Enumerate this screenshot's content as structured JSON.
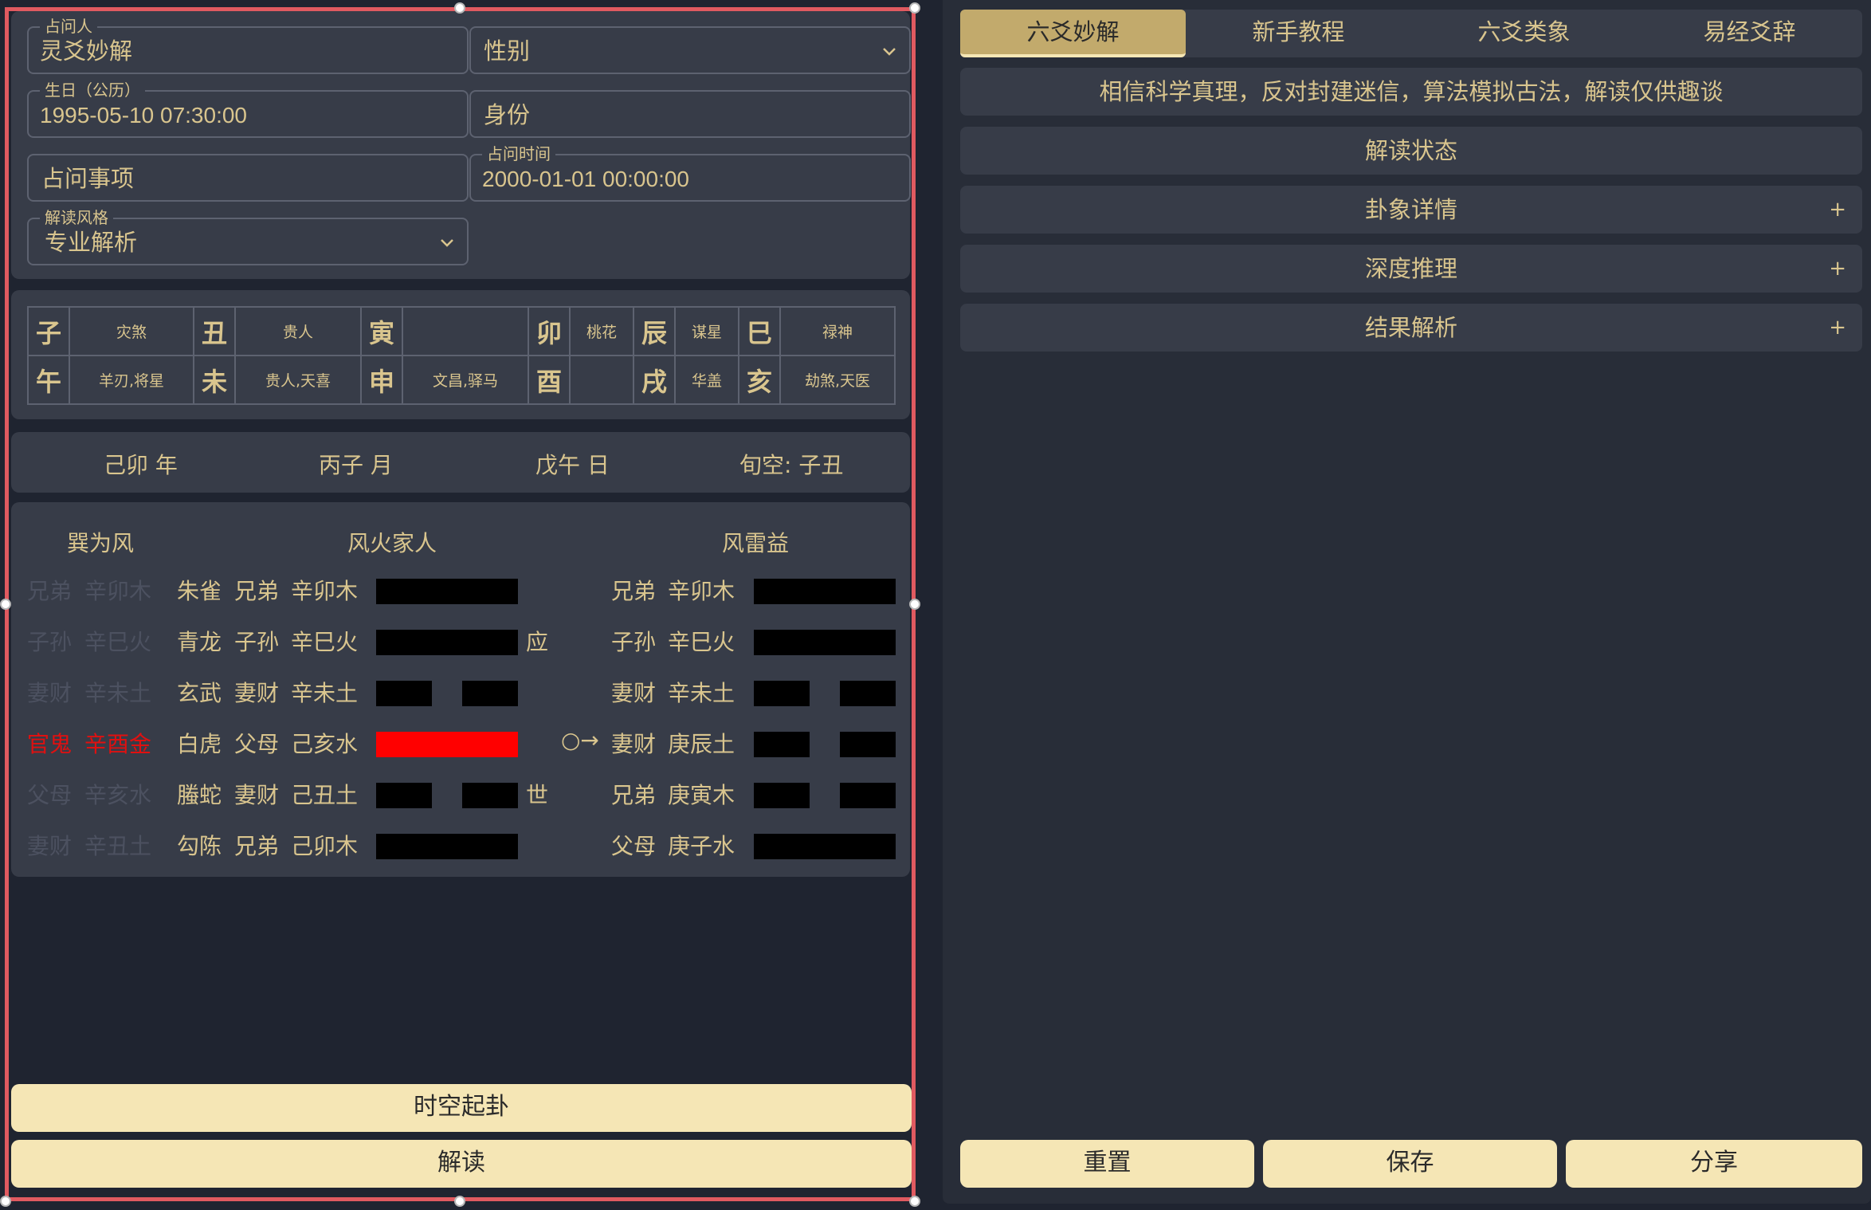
{
  "form": {
    "asker": {
      "legend": "占问人",
      "value": "灵爻妙解"
    },
    "gender": {
      "value": "性别"
    },
    "birthday": {
      "legend": "生日（公历）",
      "value": "1995-05-10 07:30:00"
    },
    "identity": {
      "value": "身份"
    },
    "matter": {
      "value": "占问事项"
    },
    "ask_time": {
      "legend": "占问时间",
      "value": "2000-01-01 00:00:00"
    },
    "style": {
      "legend": "解读风格",
      "value": "专业解析"
    }
  },
  "branches": [
    [
      {
        "zhi": "子",
        "shen": "灾煞"
      },
      {
        "zhi": "丑",
        "shen": "贵人"
      },
      {
        "zhi": "寅",
        "shen": ""
      },
      {
        "zhi": "卯",
        "shen": "桃花"
      },
      {
        "zhi": "辰",
        "shen": "谋星"
      },
      {
        "zhi": "巳",
        "shen": "禄神"
      }
    ],
    [
      {
        "zhi": "午",
        "shen": "羊刃,将星"
      },
      {
        "zhi": "未",
        "shen": "贵人,天喜"
      },
      {
        "zhi": "申",
        "shen": "文昌,驿马"
      },
      {
        "zhi": "酉",
        "shen": ""
      },
      {
        "zhi": "戌",
        "shen": "华盖"
      },
      {
        "zhi": "亥",
        "shen": "劫煞,天医"
      }
    ]
  ],
  "pillars": {
    "year": "己卯 年",
    "month": "丙子 月",
    "day": "戊午 日",
    "void": "旬空: 子丑"
  },
  "gua": {
    "fu_shen_title": "巽为风",
    "main_title": "风火家人",
    "changed_title": "风雷益",
    "rows": [
      {
        "fu_rel": "兄弟",
        "fu_gz": "辛卯木",
        "fu_highlight": false,
        "spirit": "朱雀",
        "rel": "兄弟",
        "gz": "辛卯木",
        "yang": true,
        "moving": false,
        "mark": "",
        "arrow": "",
        "c_rel": "兄弟",
        "c_gz": "辛卯木",
        "c_yang": true
      },
      {
        "fu_rel": "子孙",
        "fu_gz": "辛巳火",
        "fu_highlight": false,
        "spirit": "青龙",
        "rel": "子孙",
        "gz": "辛巳火",
        "yang": true,
        "moving": false,
        "mark": "应",
        "arrow": "",
        "c_rel": "子孙",
        "c_gz": "辛巳火",
        "c_yang": true
      },
      {
        "fu_rel": "妻财",
        "fu_gz": "辛未土",
        "fu_highlight": false,
        "spirit": "玄武",
        "rel": "妻财",
        "gz": "辛未土",
        "yang": false,
        "moving": false,
        "mark": "",
        "arrow": "",
        "c_rel": "妻财",
        "c_gz": "辛未土",
        "c_yang": false
      },
      {
        "fu_rel": "官鬼",
        "fu_gz": "辛酉金",
        "fu_highlight": true,
        "spirit": "白虎",
        "rel": "父母",
        "gz": "己亥水",
        "yang": true,
        "moving": true,
        "mark": "",
        "arrow": "○→",
        "c_rel": "妻财",
        "c_gz": "庚辰土",
        "c_yang": false
      },
      {
        "fu_rel": "父母",
        "fu_gz": "辛亥水",
        "fu_highlight": false,
        "spirit": "螣蛇",
        "rel": "妻财",
        "gz": "己丑土",
        "yang": false,
        "moving": false,
        "mark": "世",
        "arrow": "",
        "c_rel": "兄弟",
        "c_gz": "庚寅木",
        "c_yang": false
      },
      {
        "fu_rel": "妻财",
        "fu_gz": "辛丑土",
        "fu_highlight": false,
        "spirit": "勾陈",
        "rel": "兄弟",
        "gz": "己卯木",
        "yang": true,
        "moving": false,
        "mark": "",
        "arrow": "",
        "c_rel": "父母",
        "c_gz": "庚子水",
        "c_yang": true
      }
    ]
  },
  "buttons": {
    "cast": "时空起卦",
    "interpret": "解读",
    "reset": "重置",
    "save": "保存",
    "share": "分享"
  },
  "tabs": [
    "六爻妙解",
    "新手教程",
    "六爻类象",
    "易经爻辞"
  ],
  "notice": "相信科学真理，反对封建迷信，算法模拟古法，解读仅供趣谈",
  "sections": {
    "status": "解读状态",
    "detail": "卦象详情",
    "reasoning": "深度推理",
    "result": "结果解析",
    "plus": "+"
  },
  "colors": {
    "accent": "#c2aa6c",
    "text": "#d9c58e",
    "button": "#f5e6b5",
    "moving_line": "#ff0000",
    "selection": "#e05a60"
  },
  "icons": {
    "dropdown": "chevron-down-icon"
  }
}
